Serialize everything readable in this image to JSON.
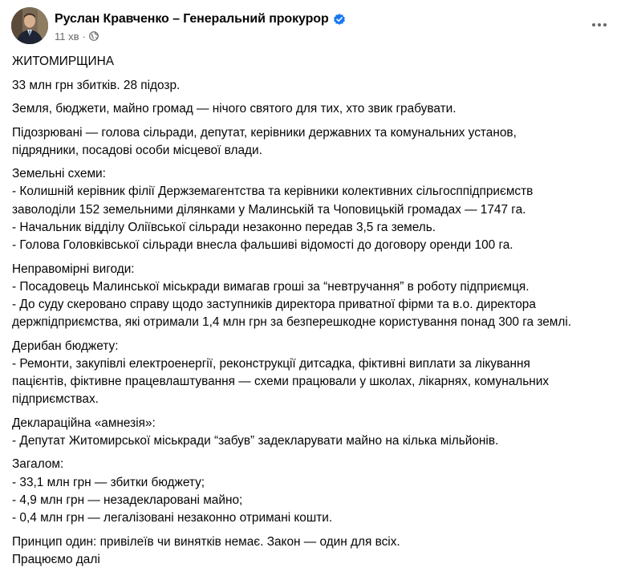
{
  "post": {
    "author_name": "Руслан Кравченко – Генеральний прокурор",
    "timestamp": "11 хв",
    "icons": {
      "verified": "verified-badge-icon",
      "audience": "globe-icon",
      "more": "more-options-icon"
    },
    "colors": {
      "verified": "#1877f2",
      "meta": "#65676b",
      "text": "#050505"
    },
    "paragraphs": [
      {
        "lines": [
          "ЖИТОМИРЩИНА"
        ]
      },
      {
        "lines": [
          "33 млн грн збитків. 28 підозр."
        ]
      },
      {
        "lines": [
          "Земля, бюджети, майно громад — нічого святого для тих, хто звик грабувати."
        ]
      },
      {
        "lines": [
          "Підозрювані — голова сільради, депутат, керівники державних та комунальних установ,",
          "підрядники, посадові особи місцевої влади."
        ]
      },
      {
        "lines": [
          "Земельні схеми:",
          "- Колишній керівник філії Держземагентства та керівники колективних сільгосппідприємств",
          "заволоділи 152 земельними ділянками у Малинській та Чоповицькій громадах — 1747 га.",
          "- Начальник відділу Оліївської сільради незаконно передав 3,5 га земель.",
          "- Голова Головківської сільради внесла фальшиві відомості до договору оренди 100 га."
        ]
      },
      {
        "lines": [
          "Неправомірні вигоди:",
          "- Посадовець Малинської міськради вимагав гроші за “невтручання” в роботу підприємця.",
          "- До суду скеровано справу щодо заступників директора приватної фірми та в.о. директора",
          "держпідприємства, які отримали 1,4 млн грн за безперешкодне користування понад 300 га землі."
        ]
      },
      {
        "lines": [
          "Дерибан бюджету:",
          "- Ремонти, закупівлі електроенергії, реконструкції дитсадка, фіктивні виплати за лікування",
          "пацієнтів, фіктивне працевлаштування — схеми працювали у школах, лікарнях, комунальних",
          "підприємствах."
        ]
      },
      {
        "lines": [
          "Деклараційна «амнезія»:",
          "- Депутат Житомирської міськради “забув” задекларувати майно на кілька мільйонів."
        ]
      },
      {
        "lines": [
          "Загалом:",
          "- 33,1 млн грн — збитки бюджету;",
          "- 4,9 млн грн — незадекларовані майно;",
          "- 0,4 млн грн — легалізовані незаконно отримані кошти."
        ]
      },
      {
        "lines": [
          "Принцип один: привілеїв чи винятків немає. Закон — один для всіх.",
          "Працюємо далі"
        ]
      }
    ]
  }
}
